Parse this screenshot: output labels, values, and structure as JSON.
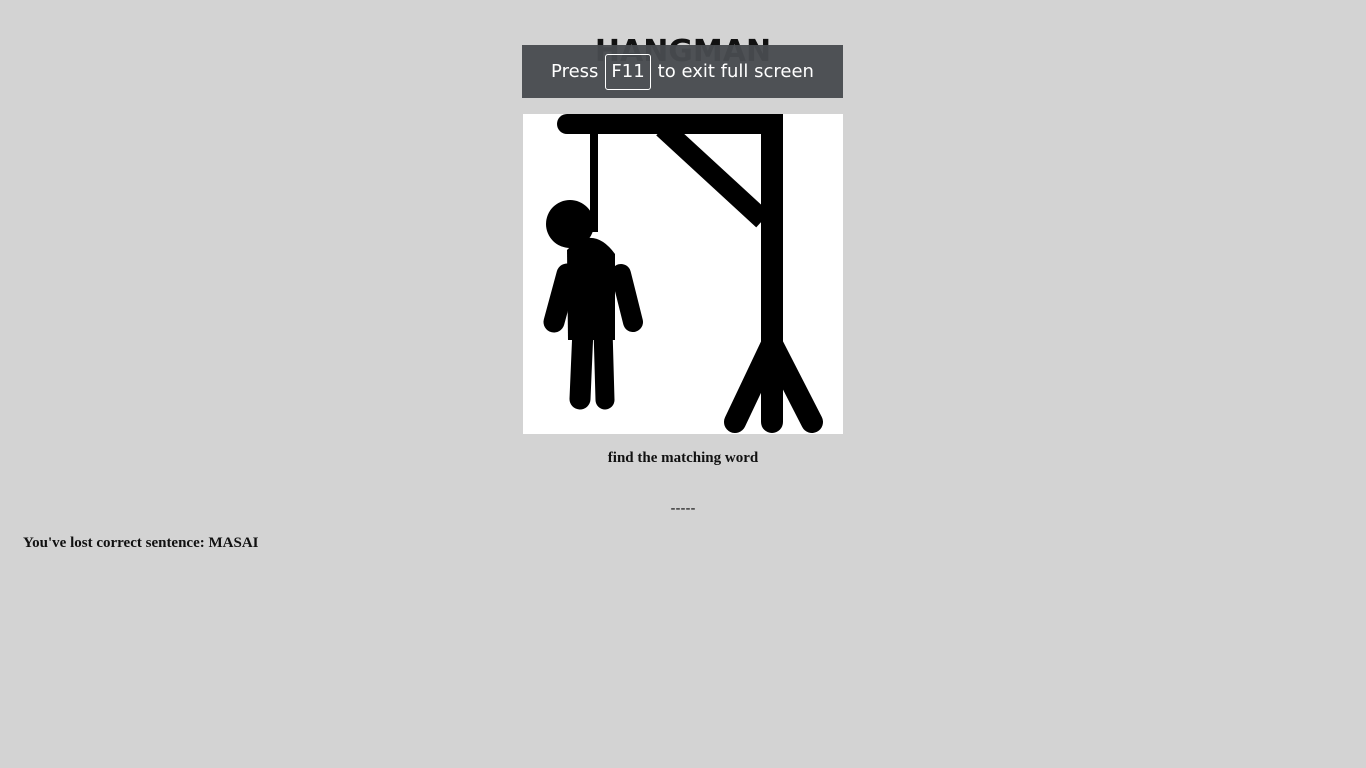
{
  "game": {
    "title": "HANGMAN",
    "hint": "find the matching word",
    "masked_word": "-----",
    "result_message": "You've lost correct sentence: MASAI",
    "wrong_guesses": 6,
    "max_guesses": 6
  },
  "fullscreen_notice": {
    "prefix": "Press",
    "key": "F11",
    "suffix": "to exit full screen"
  },
  "colors": {
    "background": "#d3d3d3",
    "drawing": "#000000",
    "canvas": "#ffffff"
  }
}
